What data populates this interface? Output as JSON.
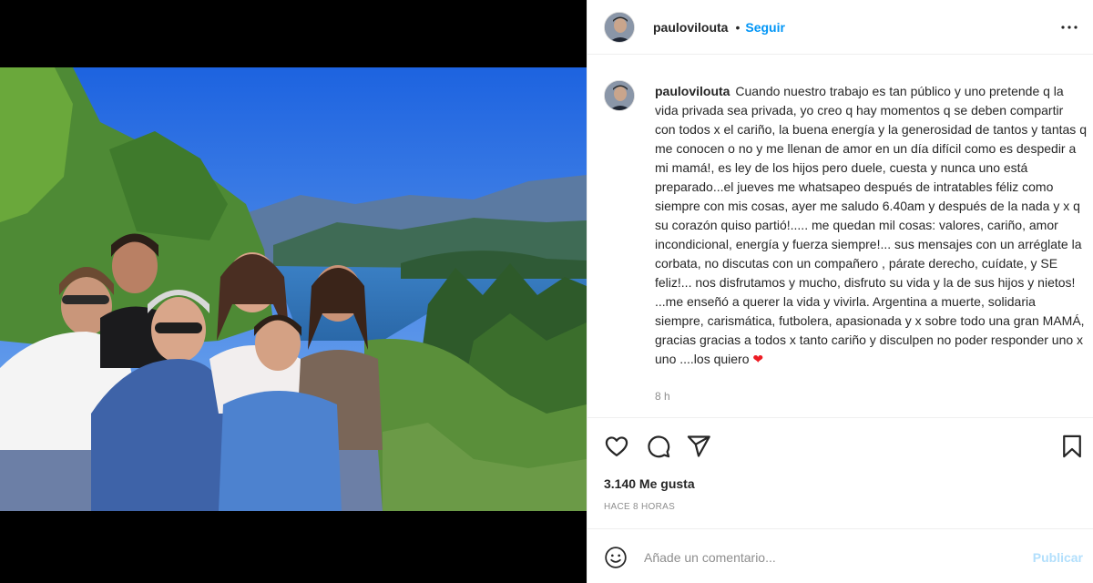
{
  "post": {
    "username": "paulovilouta",
    "separator": "•",
    "follow_label": "Seguir",
    "caption_text": "Cuando nuestro trabajo es tan público y uno pretende q la vida privada sea privada, yo creo q hay momentos q se deben compartir con todos x el cariño, la buena energía y la generosidad de tantos y tantas q me conocen o no y me llenan de amor en un día difícil como es despedir a mi mamá!, es ley de los hijos pero duele, cuesta y nunca uno está preparado...el jueves me whatsapeo después de intratables féliz como siempre con mis cosas, ayer me saludo 6.40am y después de la nada y x q su corazón quiso partió!..... me quedan mil cosas: valores, cariño, amor incondicional, energía y fuerza siempre!... sus mensajes con un arréglate la corbata, no discutas con un compañero , párate derecho, cuídate, y SE feliz!... nos disfrutamos y mucho, disfruto su vida y la de sus hijos y nietos! ...me enseñó a querer la vida y vivirla. Argentina a muerte, solidaria siempre, carismática, futbolera, apasionada y x sobre todo una gran MAMÁ, gracias gracias a todos x tanto cariño y disculpen no poder responder uno x uno ....los quiero",
    "caption_emoji": "❤",
    "caption_time": "8 h",
    "likes": "3.140 Me gusta",
    "posted_ago": "HACE 8 HORAS"
  },
  "comment": {
    "placeholder": "Añade un comentario...",
    "publish_label": "Publicar"
  },
  "icons": {
    "more": "more-options-icon",
    "like": "heart-icon",
    "comment": "comment-icon",
    "share": "share-icon",
    "save": "bookmark-icon",
    "emoji": "emoji-icon"
  },
  "colors": {
    "accent": "#0095f6",
    "publish_disabled": "#b2dffc",
    "heart": "#ed1c24"
  }
}
